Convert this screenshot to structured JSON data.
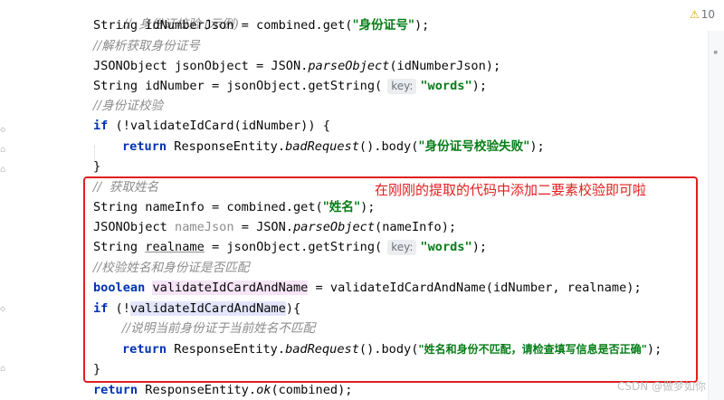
{
  "editor": {
    "warning_count": "10",
    "annotation": "在刚刚的提取的代码中添加二要素校验即可啦",
    "watermark": "CSDN @做梦如你"
  },
  "lines": {
    "l0": "//  身份证校验 (示例)",
    "l1_a": "String idNumberJson = combined.get(",
    "l1_s": "\"身份证号\"",
    "l1_b": ");",
    "l2": "//解析获取身份证号",
    "l3_a": "JSONObject jsonObject = JSON.",
    "l3_m": "parseObject",
    "l3_b": "(idNumberJson);",
    "l4_a": "String idNumber = jsonObject.getString(",
    "l4_hint": "key:",
    "l4_s": "\"words\"",
    "l4_b": ");",
    "l5": "//身份证校验",
    "l6_kw": "if",
    "l6_b": " (!validateIdCard(idNumber)) {",
    "l7_kw": "return",
    "l7_a": " ResponseEntity.",
    "l7_m": "badRequest",
    "l7_b": "().body(",
    "l7_s": "\"身份证号校验失败\"",
    "l7_c": ");",
    "l8": "}",
    "l9": "//  获取姓名",
    "l10_a": "String nameInfo = combined.get(",
    "l10_s": "\"姓名\"",
    "l10_b": ");",
    "l11_a": "JSONObject ",
    "l11_u": "nameJson",
    "l11_b": " = JSON.",
    "l11_m": "parseObject",
    "l11_c": "(nameInfo);",
    "l12_a": "String ",
    "l12_u": "realname",
    "l12_b": " = jsonObject.getString(",
    "l12_hint": "key:",
    "l12_s": "\"words\"",
    "l12_c": ");",
    "l13": "//校验姓名和身份证是否匹配",
    "l14_kw": "boolean",
    "l14_sp": " ",
    "l14_v": "validateIdCardAndName",
    "l14_b": " = validateIdCardAndName(idNumber, realname);",
    "l15_kw": "if",
    "l15_a": " (!",
    "l15_v1": "validate",
    "l15_v2": "IdCardAndName",
    "l15_b": "){",
    "l16": "//说明当前身份证于当前姓名不匹配",
    "l17_kw": "return",
    "l17_a": " ResponseEntity.",
    "l17_m": "badRequest",
    "l17_b": "().body(",
    "l17_s": "\"姓名和身份不匹配，请检查填写信息是否正确\"",
    "l17_c": ");",
    "l18": "}",
    "l19_kw": "return",
    "l19_a": " ResponseEntity.",
    "l19_m": "ok",
    "l19_b": "(combined);"
  },
  "colors": {
    "keyword": "#0033b3",
    "string": "#067d17",
    "comment": "#8c8c8c",
    "annotation_red": "#e0201f"
  }
}
